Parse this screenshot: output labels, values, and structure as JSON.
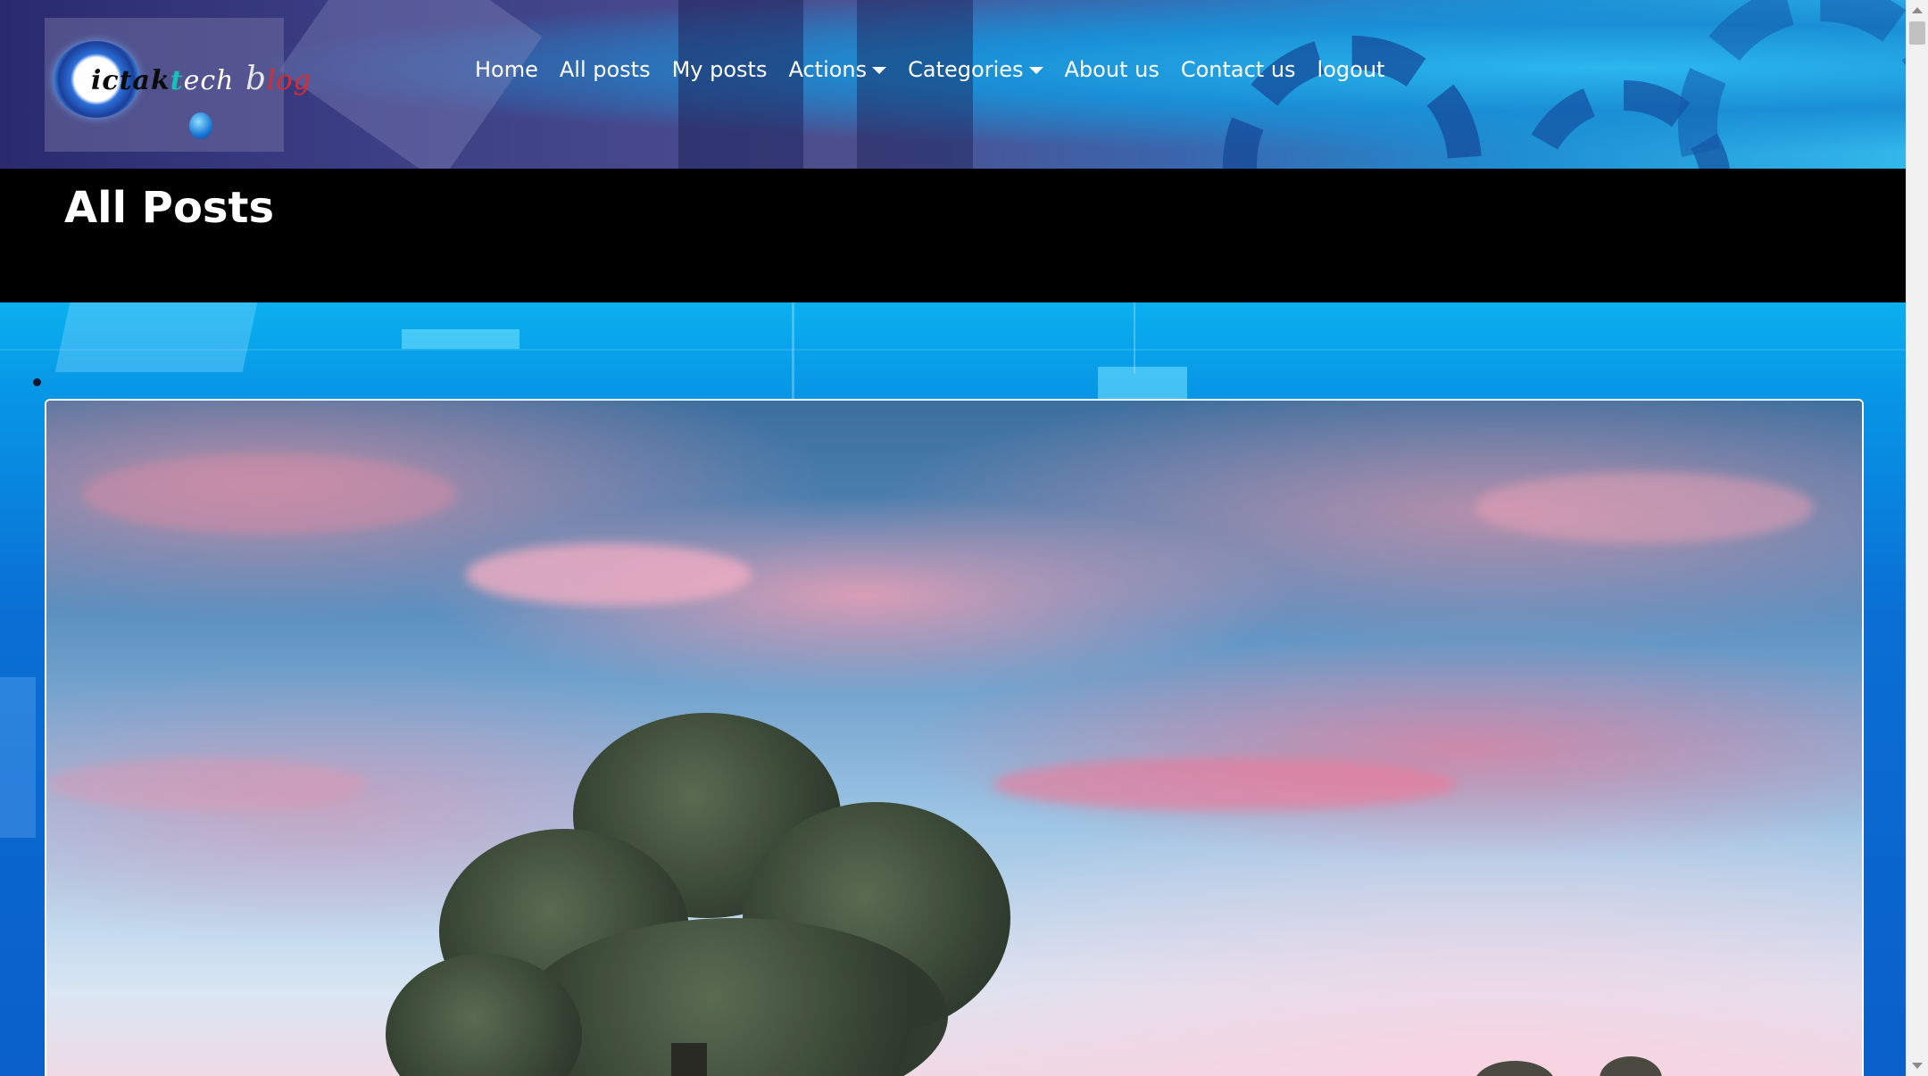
{
  "header": {
    "logo": {
      "parts": [
        "i",
        "ctak",
        "t",
        "ech",
        " b",
        "log"
      ]
    },
    "nav": {
      "items": [
        {
          "label": "Home"
        },
        {
          "label": "All posts"
        },
        {
          "label": "My posts"
        },
        {
          "label": "Actions",
          "dropdown": true
        },
        {
          "label": "Categories",
          "dropdown": true
        },
        {
          "label": "About us"
        },
        {
          "label": "Contact us"
        },
        {
          "label": "logout"
        }
      ]
    }
  },
  "title_band": {
    "title": "All Posts"
  },
  "colors": {
    "title_band_bg": "#000000",
    "nav_text": "#ffffff",
    "main_bg": "#0a6fd4"
  },
  "icons": {
    "dropdown": "caret-down-icon",
    "list_bullet": "bullet-icon",
    "scroll_up": "scroll-up-arrow-icon",
    "scroll_down": "scroll-down-arrow-icon"
  }
}
